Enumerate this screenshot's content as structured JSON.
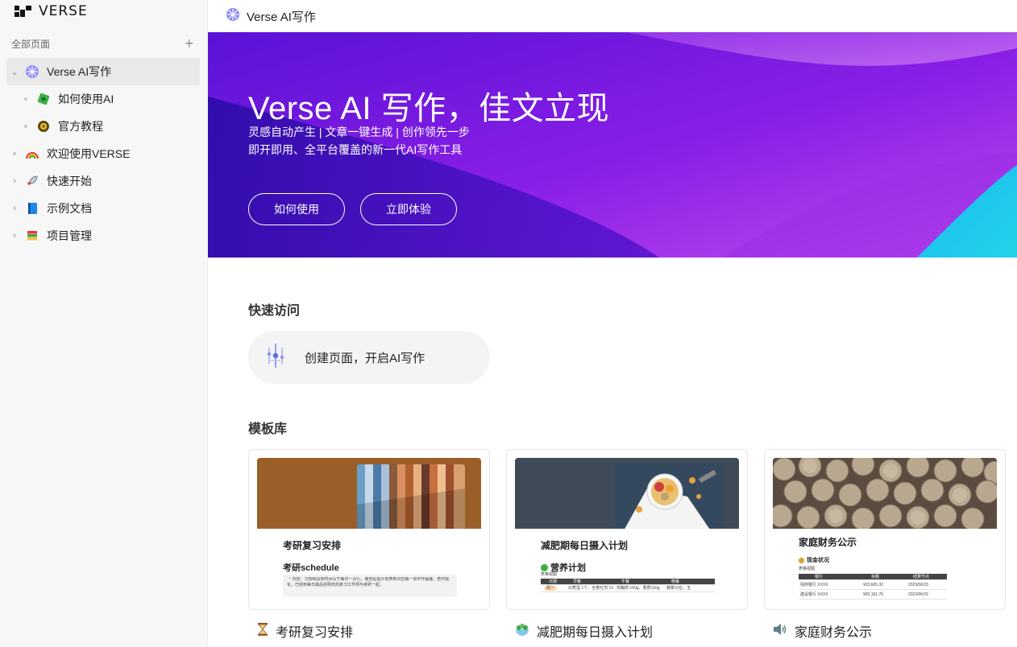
{
  "brand": {
    "name": "VERSE"
  },
  "sidebar": {
    "all_pages_label": "全部页面",
    "add_label": "+",
    "items": [
      {
        "label": "Verse AI写作",
        "icon": "brain-icon"
      },
      {
        "label": "如何使用AI",
        "icon": "puzzle-icon"
      },
      {
        "label": "官方教程",
        "icon": "gear-icon"
      },
      {
        "label": "欢迎使用VERSE",
        "icon": "rainbow-icon"
      },
      {
        "label": "快速开始",
        "icon": "rocket-icon"
      },
      {
        "label": "示例文档",
        "icon": "book-icon"
      },
      {
        "label": "项目管理",
        "icon": "books-icon"
      }
    ]
  },
  "topbar": {
    "title": "Verse AI写作"
  },
  "banner": {
    "title": "Verse AI 写作，佳文立现",
    "subtitle1": "灵感自动产生 | 文章一键生成 | 创作领先一步",
    "subtitle2": "即开即用、全平台覆盖的新一代AI写作工具",
    "btn_how": "如何使用",
    "btn_try": "立即体验"
  },
  "quick_access": {
    "heading": "快速访问",
    "create_label": "创建页面，开启AI写作"
  },
  "templates": {
    "heading": "模板库",
    "cards": [
      {
        "doc_title": "考研复习安排",
        "doc_sub": "考研schedule",
        "quote": "「 内容：习惯和具体时间写于每日一页行，做完后需计划表到对应每一周中作最差，若可视化，已经到每日最后处明天的复习工作项与考研一起。",
        "label": "考研复习安排",
        "icon": "hourglass-icon"
      },
      {
        "doc_title": "减肥期每日摄入计划",
        "doc_sub": "营养计划",
        "table_view": "表格视图",
        "cols": [
          "日期",
          "早餐",
          "午餐",
          "晚餐"
        ],
        "row": [
          "周一",
          "白煮蛋 1个，全麦吐司 1片",
          "鸡胸肉 150g，香蕉150g",
          "蔬菜沙拉，玉"
        ],
        "label": "减肥期每日摄入计划",
        "icon": "salad-icon"
      },
      {
        "doc_title": "家庭财务公示",
        "doc_sub": "现金状况",
        "table_view": "表格视图",
        "cols": [
          "银行",
          "余额",
          "结算节点"
        ],
        "rows": [
          [
            "招商银行 XXXX",
            "¥23,665.32",
            "2023/06/15"
          ],
          [
            "建设银行 XXXX",
            "¥93,161.76",
            "2023/06/15"
          ]
        ],
        "label": "家庭财务公示",
        "icon": "speaker-icon"
      }
    ]
  },
  "colors": {
    "banner_purple": "#7a1fe0",
    "banner_deep": "#3f0fb8",
    "banner_cyan": "#1cc6ea",
    "sidebar_bg": "#f7f7f7"
  }
}
